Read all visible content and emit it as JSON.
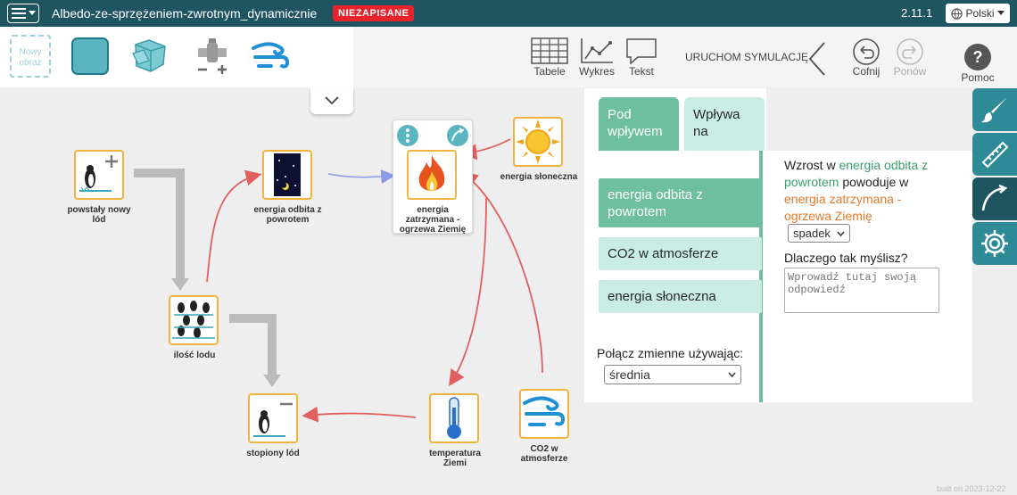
{
  "topbar": {
    "title": "Albedo-ze-sprzężeniem-zwrotnym_dynamicznie",
    "unsaved_badge": "NIEZAPISANE",
    "version": "2.11.1",
    "language": "Polski",
    "menu_icon": "hamburger-icon"
  },
  "toolbar": {
    "new_image": "Nowy obraz",
    "tables": "Tabele",
    "chart": "Wykres",
    "text": "Tekst",
    "run_simulation": "URUCHOM SYMULACJĘ",
    "undo": "Cofnij",
    "redo": "Ponów",
    "help": "Pomoc"
  },
  "nodes": {
    "new_ice": "powstały nowy lód",
    "reflected_energy": "energia odbita z powrotem",
    "trapped_energy": "energia zatrzymana - ogrzewa Ziemię",
    "solar_energy": "energia słoneczna",
    "ice_amount": "ilość lodu",
    "melted_ice": "stopiony lód",
    "earth_temperature": "temperatura Ziemi",
    "co2": "CO2 w atmosferze"
  },
  "panel": {
    "tab_affected_by": "Pod wpływem",
    "tab_affects": "Wpływa na",
    "variables": [
      "energia odbita z powrotem",
      "CO2 w atmosferze",
      "energia słoneczna"
    ],
    "combine_label": "Połącz zmienne używając:",
    "combine_value": "średnia",
    "relation": {
      "prefix": "Wzrost w",
      "source": "energia odbita z powrotem",
      "middle": "powoduje w",
      "target": "energia zatrzymana - ogrzewa Ziemię",
      "effect": "spadek"
    },
    "why_label": "Dlaczego tak myślisz?",
    "why_placeholder": "Wprowadź tutaj swoją odpowiedź"
  },
  "footer": {
    "built": "built on 2023-12-22"
  },
  "colors": {
    "topbar": "#1e5560",
    "accent": "#2d8a96",
    "tab_active": "#6dbf9f",
    "tab_light": "#c9ece4",
    "link_red": "#e06060",
    "link_blue": "#8a9ae8",
    "source_green": "#3a9e6a",
    "target_orange": "#e07a2e"
  }
}
